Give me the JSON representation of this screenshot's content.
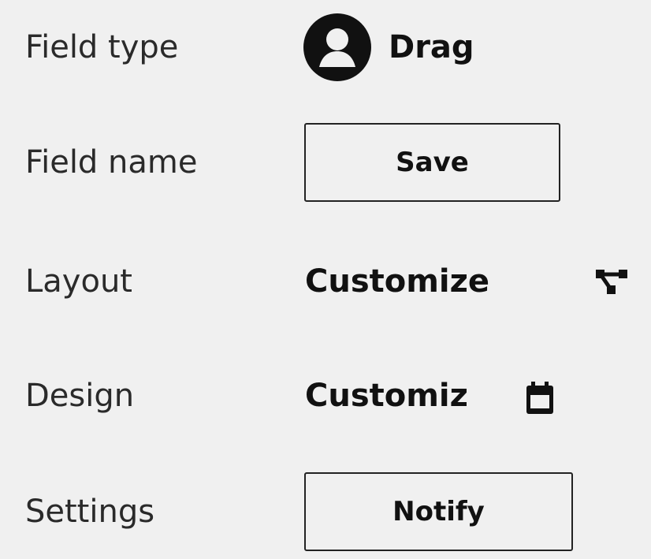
{
  "rows": [
    {
      "label": "Field type"
    },
    {
      "label": "Field name"
    },
    {
      "label": "Layout"
    },
    {
      "label": "Design"
    },
    {
      "label": "Settings"
    }
  ],
  "field_type": {
    "value": "Drag",
    "icon": "user-avatar-icon"
  },
  "field_name": {
    "button_label": "Save"
  },
  "layout": {
    "value": "Customize",
    "icon": "share-nodes-icon"
  },
  "design": {
    "value": "Customiz",
    "icon": "calendar-icon"
  },
  "settings": {
    "button_label": "Notify"
  },
  "colors": {
    "background": "#f0f0f0",
    "text": "#111111",
    "label_text": "#2a2a2a",
    "border": "#222222"
  }
}
